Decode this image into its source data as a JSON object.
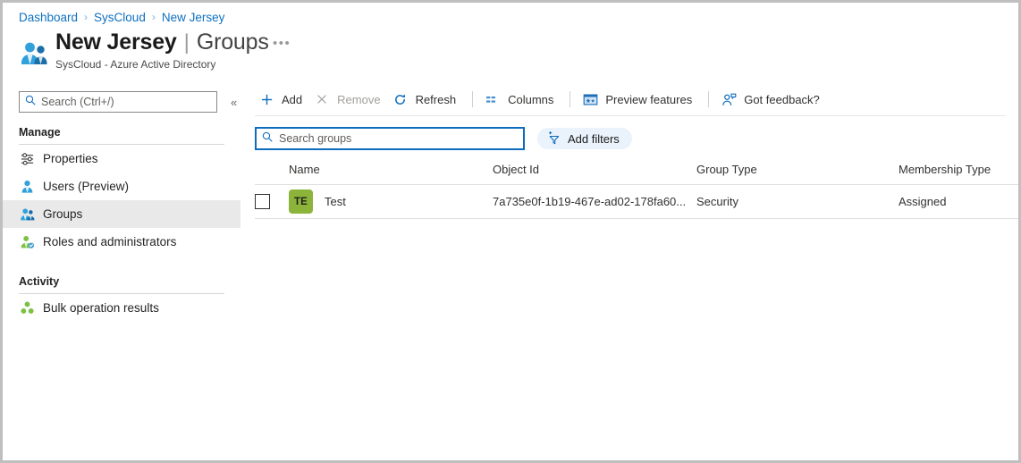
{
  "breadcrumb": {
    "items": [
      "Dashboard",
      "SysCloud",
      "New Jersey"
    ],
    "separator": "›"
  },
  "header": {
    "title": "New Jersey",
    "pipe": "|",
    "section": "Groups",
    "subtitle": "SysCloud - Azure Active Directory",
    "icon": "users-group-icon",
    "overflow_label": "•••"
  },
  "sidebar": {
    "search": {
      "placeholder": "Search (Ctrl+/)",
      "value": "",
      "icon": "search-icon"
    },
    "collapse_label": "«",
    "sections": [
      {
        "label": "Manage",
        "items": [
          {
            "label": "Properties",
            "icon": "sliders-icon",
            "active": false
          },
          {
            "label": "Users (Preview)",
            "icon": "user-icon",
            "active": false
          },
          {
            "label": "Groups",
            "icon": "users-group-icon",
            "active": true
          },
          {
            "label": "Roles and administrators",
            "icon": "user-shield-icon",
            "active": false
          }
        ]
      },
      {
        "label": "Activity",
        "items": [
          {
            "label": "Bulk operation results",
            "icon": "bulk-nodes-icon",
            "active": false
          }
        ]
      }
    ]
  },
  "toolbar": {
    "buttons": [
      {
        "label": "Add",
        "icon": "plus-icon",
        "disabled": false
      },
      {
        "label": "Remove",
        "icon": "close-x-icon",
        "disabled": true
      },
      {
        "label": "Refresh",
        "icon": "refresh-icon",
        "disabled": false
      },
      {
        "label": "Columns",
        "icon": "columns-icon",
        "disabled": false
      },
      {
        "label": "Preview features",
        "icon": "preview-features-icon",
        "disabled": false
      },
      {
        "label": "Got feedback?",
        "icon": "feedback-person-icon",
        "disabled": false
      }
    ],
    "separators_after": [
      2,
      3,
      4
    ]
  },
  "filters": {
    "search": {
      "placeholder": "Search groups",
      "value": "",
      "icon": "search-icon"
    },
    "add_filters_label": "Add filters",
    "add_filters_icon": "add-filter-icon"
  },
  "table": {
    "columns": [
      "Name",
      "Object Id",
      "Group Type",
      "Membership Type"
    ],
    "rows": [
      {
        "checked": false,
        "initials": "TE",
        "avatar_color": "#8cb43a",
        "name": "Test",
        "object_id": "7a735e0f-1b19-467e-ad02-178fa60...",
        "group_type": "Security",
        "membership_type": "Assigned"
      }
    ]
  },
  "colors": {
    "accent": "#0078d4",
    "link": "#0e70c0",
    "avatar_green": "#8cb43a",
    "active_row": "#e9e9e9"
  }
}
